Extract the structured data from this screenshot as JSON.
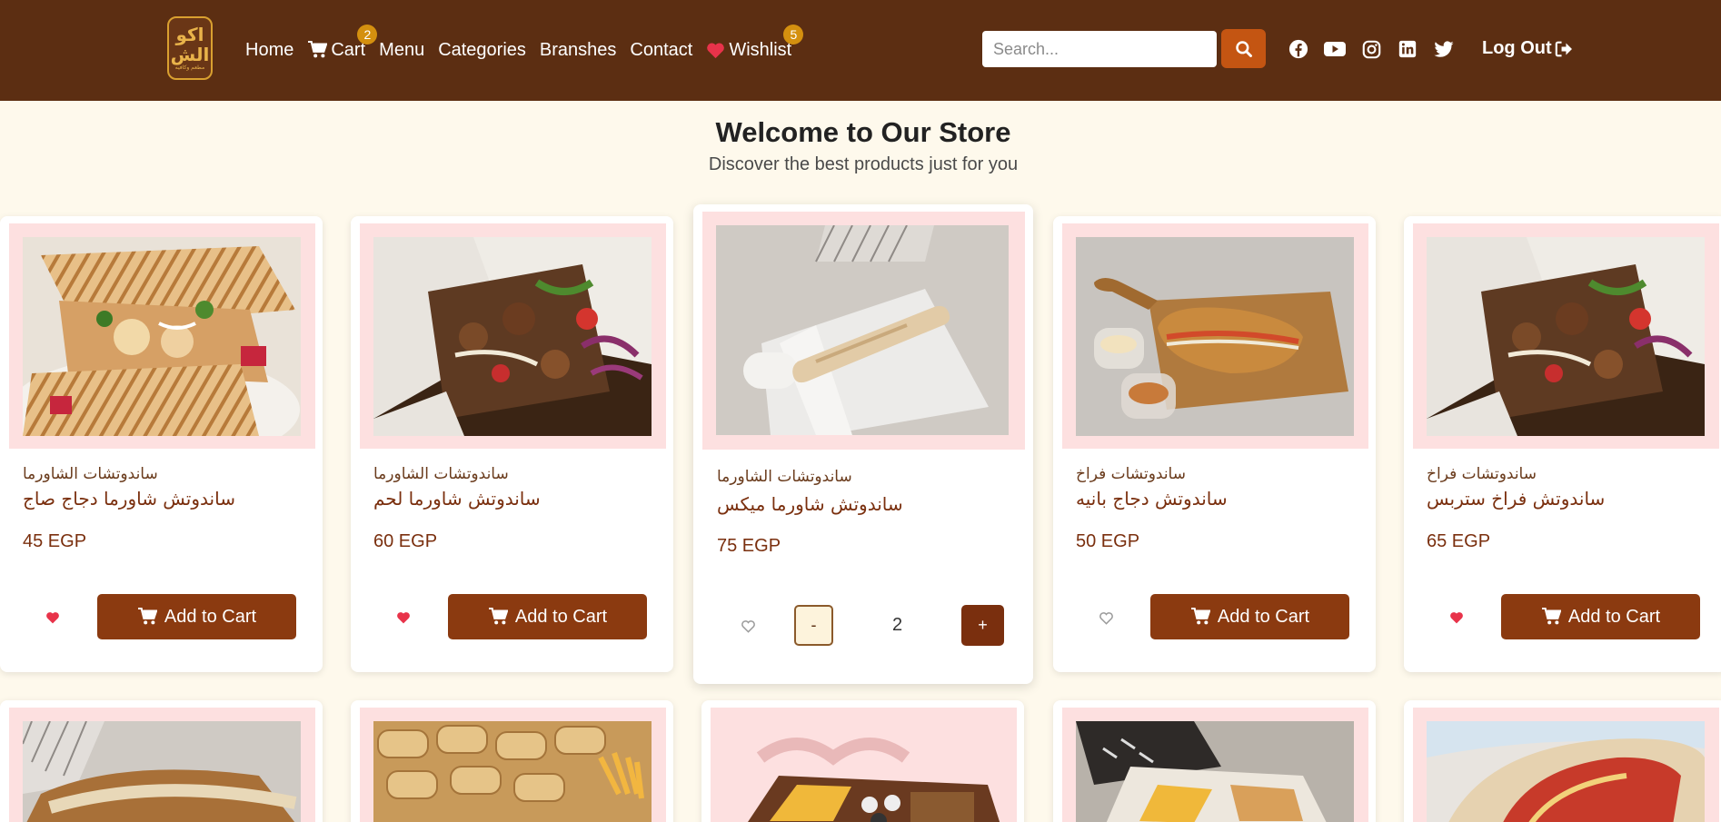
{
  "nav": {
    "logo_text": "اكو الش",
    "logo_sub": "مطعم وكافيه",
    "links": [
      {
        "label": "Home"
      },
      {
        "label": "Cart",
        "badge": "2"
      },
      {
        "label": "Menu"
      },
      {
        "label": "Categories"
      },
      {
        "label": "Branshes"
      },
      {
        "label": "Contact"
      },
      {
        "label": "Wishlist",
        "badge": "5"
      }
    ],
    "search_placeholder": "Search...",
    "social": [
      "facebook-icon",
      "youtube-icon",
      "instagram-icon",
      "linkedin-icon",
      "twitter-icon"
    ],
    "logout_label": "Log Out"
  },
  "hero": {
    "title": "Welcome to Our Store",
    "subtitle": "Discover the best products just for you"
  },
  "products": [
    {
      "category": "ساندوتشات الشاورما",
      "name": "ساندوتش شاورما دجاج صاج",
      "price": "45 EGP",
      "wishlisted": true,
      "add_label": "Add to Cart"
    },
    {
      "category": "ساندوتشات الشاورما",
      "name": "ساندوتش شاورما لحم",
      "price": "60 EGP",
      "wishlisted": true,
      "add_label": "Add to Cart"
    },
    {
      "category": "ساندوتشات الشاورما",
      "name": "ساندوتش شاورما ميكس",
      "price": "75 EGP",
      "wishlisted": false,
      "qty_minus": "-",
      "qty": "2",
      "qty_plus": "+"
    },
    {
      "category": "ساندوتشات فراخ",
      "name": "ساندوتش دجاج بانيه",
      "price": "50 EGP",
      "wishlisted": false,
      "add_label": "Add to Cart"
    },
    {
      "category": "ساندوتشات فراخ",
      "name": "ساندوتش فراخ ستربس",
      "price": "65 EGP",
      "wishlisted": true,
      "add_label": "Add to Cart"
    }
  ],
  "colors": {
    "navbar": "#5c2e12",
    "accent": "#8b3a10",
    "search_button": "#c45512",
    "badge": "#d4900f",
    "heart": "#e8334a",
    "page_bg": "#fef9ec",
    "image_frame": "#fde0e0"
  }
}
